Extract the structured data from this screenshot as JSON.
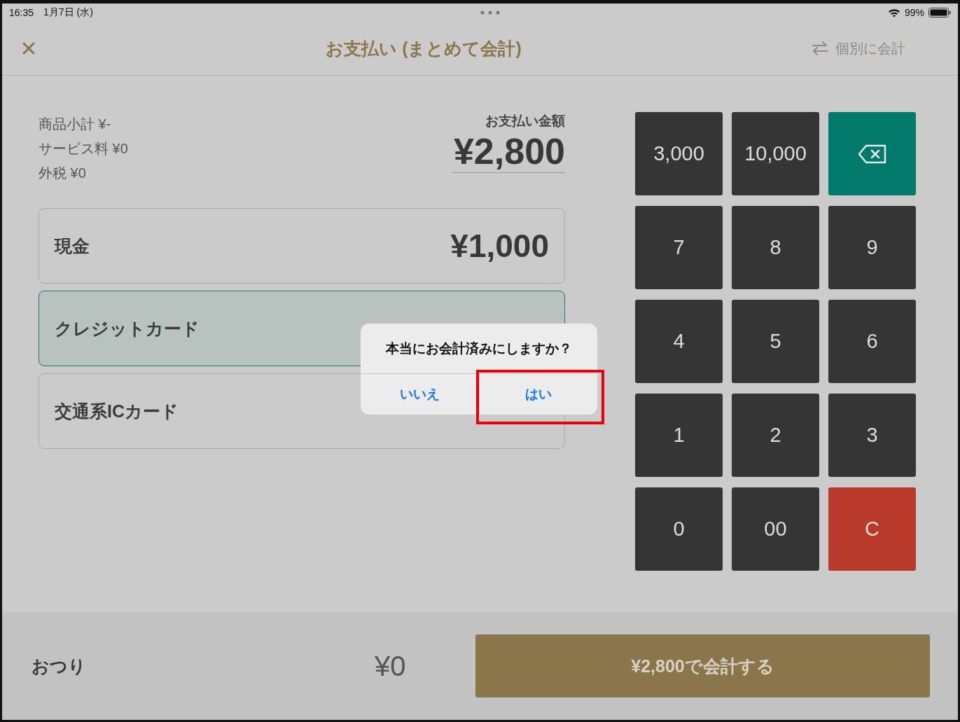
{
  "status_bar": {
    "time": "16:35",
    "date": "1月7日 (水)",
    "battery": "99%"
  },
  "header": {
    "title": "お支払い (まとめて会計)",
    "split_action": "個別に会計"
  },
  "summary": {
    "lines": [
      "商品小計 ¥-",
      "サービス料 ¥0",
      "外税 ¥0"
    ],
    "total_label": "お支払い金額",
    "total": "¥2,800"
  },
  "payments": [
    {
      "name": "現金",
      "amount": "¥1,000",
      "selected": false
    },
    {
      "name": "クレジットカード",
      "selected": true
    },
    {
      "name": "交通系ICカード",
      "selected": false
    }
  ],
  "keypad": [
    {
      "kind": "number",
      "label": "3,000"
    },
    {
      "kind": "number",
      "label": "10,000"
    },
    {
      "kind": "backspace"
    },
    {
      "kind": "number",
      "label": "7"
    },
    {
      "kind": "number",
      "label": "8"
    },
    {
      "kind": "number",
      "label": "9"
    },
    {
      "kind": "number",
      "label": "4"
    },
    {
      "kind": "number",
      "label": "5"
    },
    {
      "kind": "number",
      "label": "6"
    },
    {
      "kind": "number",
      "label": "1"
    },
    {
      "kind": "number",
      "label": "2"
    },
    {
      "kind": "number",
      "label": "3"
    },
    {
      "kind": "number",
      "label": "0"
    },
    {
      "kind": "number",
      "label": "00"
    },
    {
      "kind": "clear",
      "label": "C"
    }
  ],
  "footer": {
    "change_label": "おつり",
    "change": "¥0",
    "checkout_button": "¥2,800で会計する"
  },
  "dialog": {
    "message": "本当にお会計済みにしますか？",
    "buttons": [
      {
        "label": "いいえ",
        "highlighted": false
      },
      {
        "label": "はい",
        "highlighted": true
      }
    ]
  }
}
